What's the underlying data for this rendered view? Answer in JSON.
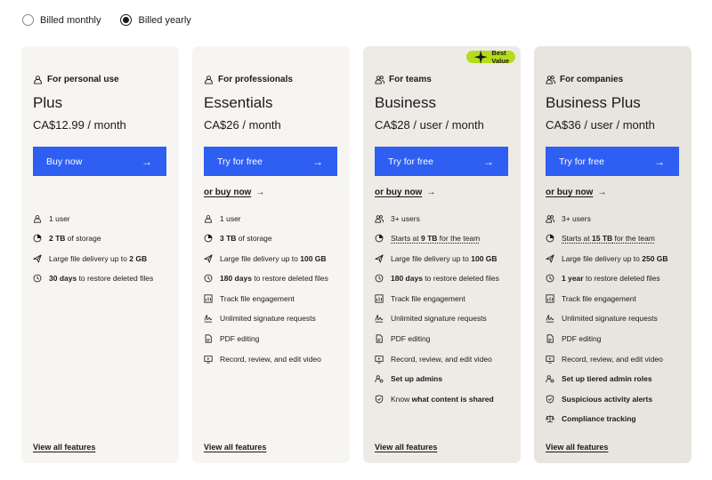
{
  "billing": {
    "monthly_label": "Billed monthly",
    "yearly_label": "Billed yearly",
    "selected": "yearly"
  },
  "colors": {
    "accent": "#2e5ff2",
    "badge": "#b4dc19"
  },
  "cards": [
    {
      "audience": "For personal use",
      "plan": "Plus",
      "price": "CA$12.99 / month",
      "cta": "Buy now",
      "secondary": "",
      "badge": "",
      "view_all": "View all features",
      "features": [
        {
          "icon": "user-icon",
          "parts": [
            {
              "t": "1 user"
            }
          ]
        },
        {
          "icon": "storage-icon",
          "parts": [
            {
              "t": "2 TB",
              "b": true
            },
            {
              "t": " of storage"
            }
          ]
        },
        {
          "icon": "send-icon",
          "parts": [
            {
              "t": "Large file delivery up to "
            },
            {
              "t": "2 GB",
              "b": true
            }
          ]
        },
        {
          "icon": "clock-restore-icon",
          "parts": [
            {
              "t": "30 days",
              "b": true
            },
            {
              "t": " to restore deleted files"
            }
          ]
        }
      ]
    },
    {
      "audience": "For professionals",
      "plan": "Essentials",
      "price": "CA$26 / month",
      "cta": "Try for free",
      "secondary": "or buy now",
      "badge": "",
      "view_all": "View all features",
      "features": [
        {
          "icon": "user-icon",
          "parts": [
            {
              "t": "1 user"
            }
          ]
        },
        {
          "icon": "storage-icon",
          "parts": [
            {
              "t": "3 TB",
              "b": true
            },
            {
              "t": " of storage"
            }
          ]
        },
        {
          "icon": "send-icon",
          "parts": [
            {
              "t": "Large file delivery up to "
            },
            {
              "t": "100 GB",
              "b": true
            }
          ]
        },
        {
          "icon": "clock-restore-icon",
          "parts": [
            {
              "t": "180 days",
              "b": true
            },
            {
              "t": " to restore deleted files"
            }
          ]
        },
        {
          "icon": "chart-icon",
          "parts": [
            {
              "t": "Track file engagement"
            }
          ]
        },
        {
          "icon": "signature-icon",
          "parts": [
            {
              "t": "Unlimited signature requests"
            }
          ]
        },
        {
          "icon": "pdf-icon",
          "parts": [
            {
              "t": "PDF editing"
            }
          ]
        },
        {
          "icon": "video-icon",
          "parts": [
            {
              "t": "Record, review, and edit video"
            }
          ]
        }
      ]
    },
    {
      "audience": "For teams",
      "plan": "Business",
      "price": "CA$28 / user / month",
      "cta": "Try for free",
      "secondary": "or buy now",
      "badge": "Best Value",
      "view_all": "View all features",
      "features": [
        {
          "icon": "users-icon",
          "parts": [
            {
              "t": "3+ users"
            }
          ]
        },
        {
          "icon": "storage-icon",
          "parts": [
            {
              "t": "Starts at ",
              "u": true
            },
            {
              "t": "9 TB",
              "b": true,
              "u": true
            },
            {
              "t": " for the team",
              "u": true
            }
          ]
        },
        {
          "icon": "send-icon",
          "parts": [
            {
              "t": "Large file delivery up to "
            },
            {
              "t": "100 GB",
              "b": true
            }
          ]
        },
        {
          "icon": "clock-restore-icon",
          "parts": [
            {
              "t": "180 days",
              "b": true
            },
            {
              "t": " to restore deleted files"
            }
          ]
        },
        {
          "icon": "chart-icon",
          "parts": [
            {
              "t": "Track file engagement"
            }
          ]
        },
        {
          "icon": "signature-icon",
          "parts": [
            {
              "t": "Unlimited signature requests"
            }
          ]
        },
        {
          "icon": "pdf-icon",
          "parts": [
            {
              "t": "PDF editing"
            }
          ]
        },
        {
          "icon": "video-icon",
          "parts": [
            {
              "t": "Record, review, and edit video"
            }
          ]
        },
        {
          "icon": "admin-icon",
          "parts": [
            {
              "t": "Set up admins",
              "b": true
            }
          ]
        },
        {
          "icon": "shield-icon",
          "parts": [
            {
              "t": "Know "
            },
            {
              "t": "what content is shared",
              "b": true
            }
          ]
        }
      ]
    },
    {
      "audience": "For companies",
      "plan": "Business Plus",
      "price": "CA$36 / user / month",
      "cta": "Try for free",
      "secondary": "or buy now",
      "badge": "",
      "view_all": "View all features",
      "features": [
        {
          "icon": "users-icon",
          "parts": [
            {
              "t": "3+ users"
            }
          ]
        },
        {
          "icon": "storage-icon",
          "parts": [
            {
              "t": "Starts at ",
              "u": true
            },
            {
              "t": "15 TB",
              "b": true,
              "u": true
            },
            {
              "t": " for the team",
              "u": true
            }
          ]
        },
        {
          "icon": "send-icon",
          "parts": [
            {
              "t": "Large file delivery up to "
            },
            {
              "t": "250 GB",
              "b": true
            }
          ]
        },
        {
          "icon": "clock-restore-icon",
          "parts": [
            {
              "t": "1 year",
              "b": true
            },
            {
              "t": " to restore deleted files"
            }
          ]
        },
        {
          "icon": "chart-icon",
          "parts": [
            {
              "t": "Track file engagement"
            }
          ]
        },
        {
          "icon": "signature-icon",
          "parts": [
            {
              "t": "Unlimited signature requests"
            }
          ]
        },
        {
          "icon": "pdf-icon",
          "parts": [
            {
              "t": "PDF editing"
            }
          ]
        },
        {
          "icon": "video-icon",
          "parts": [
            {
              "t": "Record, review, and edit video"
            }
          ]
        },
        {
          "icon": "admin-icon",
          "parts": [
            {
              "t": "Set up tiered admin roles",
              "b": true
            }
          ]
        },
        {
          "icon": "shield-icon",
          "parts": [
            {
              "t": "Suspicious activity alerts",
              "b": true
            }
          ]
        },
        {
          "icon": "scale-icon",
          "parts": [
            {
              "t": "Compliance tracking",
              "b": true
            }
          ]
        }
      ]
    }
  ]
}
